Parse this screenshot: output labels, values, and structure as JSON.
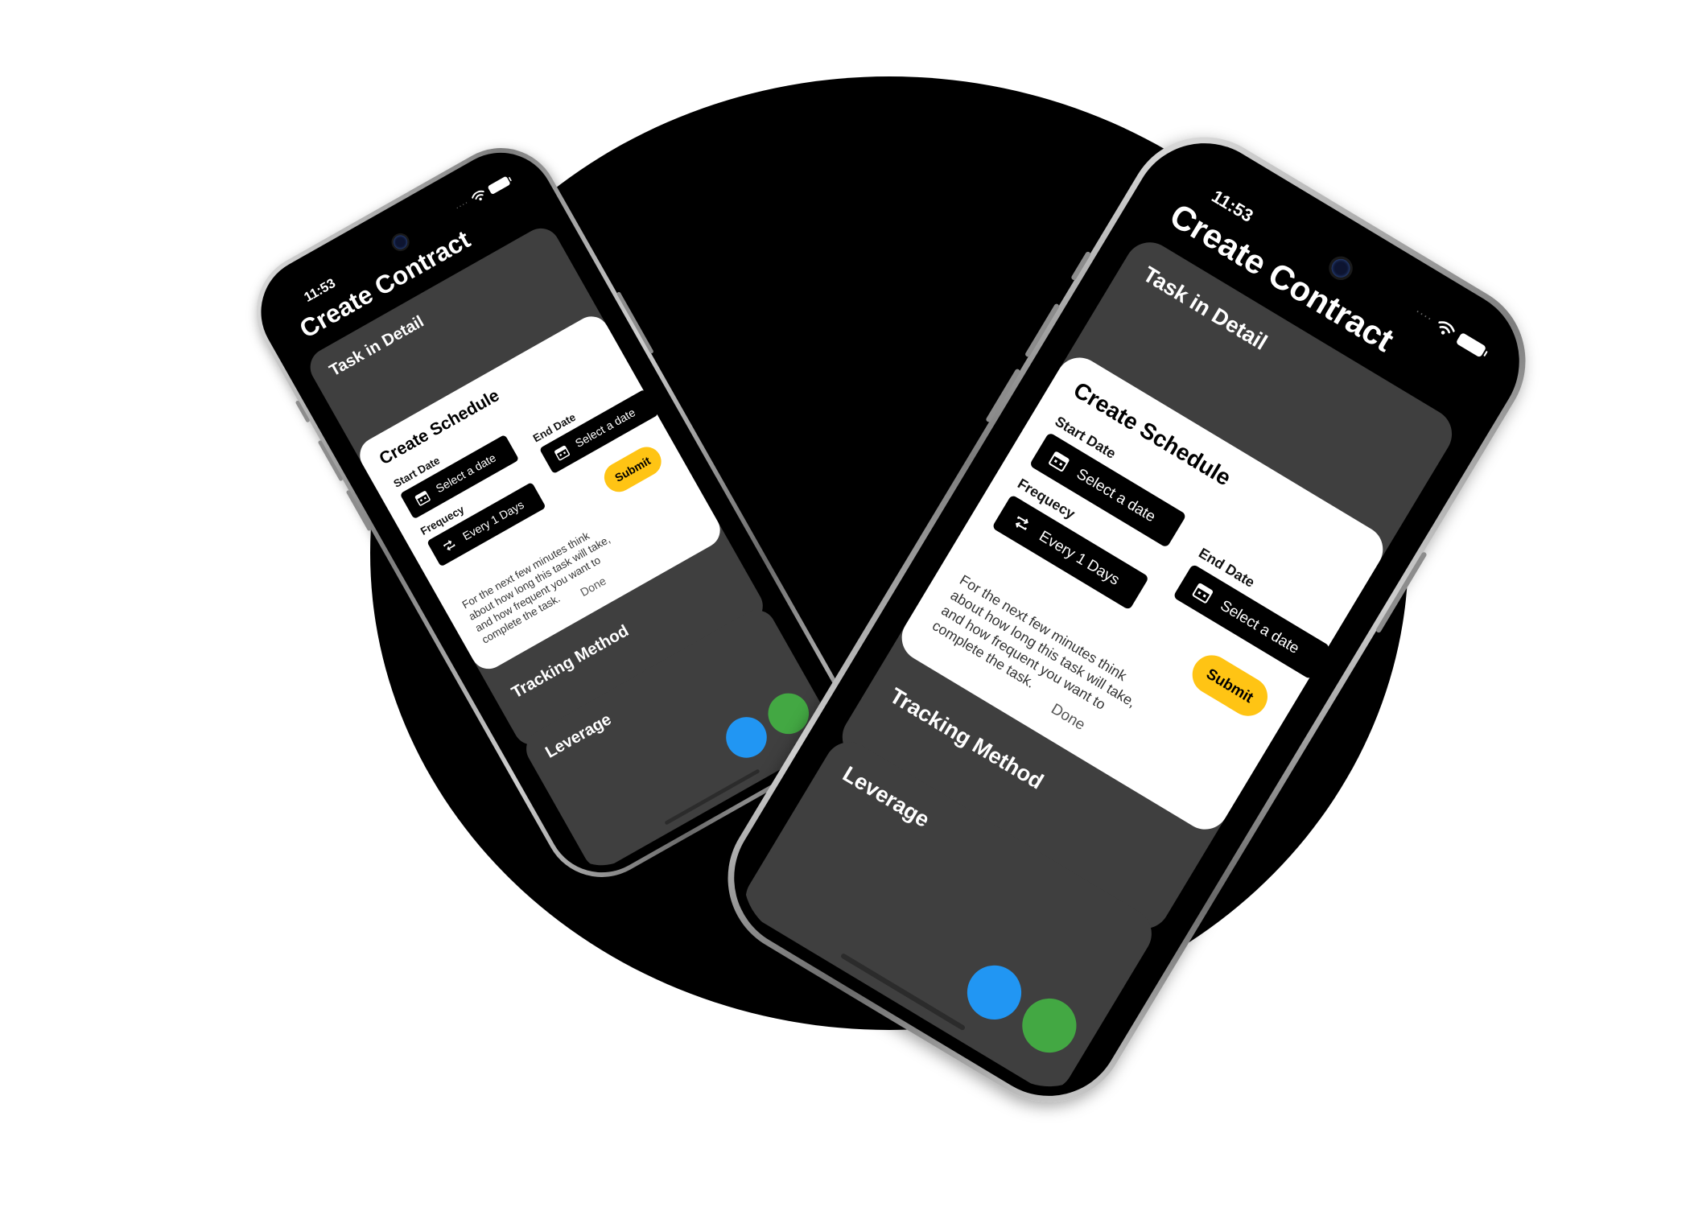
{
  "colors": {
    "accent_blue": "#2196f3",
    "accent_green": "#43a843",
    "submit_yellow": "#ffc414",
    "card_gray": "#3f3f3f",
    "background_black": "#000000"
  },
  "phones": {
    "small": {
      "status": {
        "time": "11:53",
        "signal": "····"
      },
      "title": "Create Contract",
      "task_card": {
        "label": "Task in Detail"
      },
      "schedule": {
        "title": "Create Schedule",
        "start_label": "Start Date",
        "start_value": "Select a date",
        "end_label": "End Date",
        "end_value": "Select a date",
        "frequency_label": "Frequecy",
        "frequency_value": "Every 1 Days",
        "submit_label": "Submit",
        "help_text": "For the next few minutes think about how long this task will take, and how frequent you want to complete the task.",
        "done_label": "Done"
      },
      "tracking_card": {
        "label": "Tracking Method"
      },
      "leverage_card": {
        "label": "Leverage"
      }
    },
    "large": {
      "status": {
        "time": "11:53",
        "signal": "····"
      },
      "title": "Create Contract",
      "task_card": {
        "label": "Task in Detail"
      },
      "schedule": {
        "title": "Create Schedule",
        "start_label": "Start Date",
        "start_value": "Select a date",
        "end_label": "End Date",
        "end_value": "Select a date",
        "frequency_label": "Frequecy",
        "frequency_value": "Every 1 Days",
        "submit_label": "Submit",
        "help_text": "For the next few minutes think about how long this task will take, and how frequent you want to complete the task.",
        "done_label": "Done"
      },
      "tracking_card": {
        "label": "Tracking Method"
      },
      "leverage_card": {
        "label": "Leverage"
      }
    }
  },
  "icons": {
    "calendar": "calendar-icon",
    "repeat": "repeat-icon",
    "wifi": "wifi-icon",
    "battery": "battery-icon"
  }
}
